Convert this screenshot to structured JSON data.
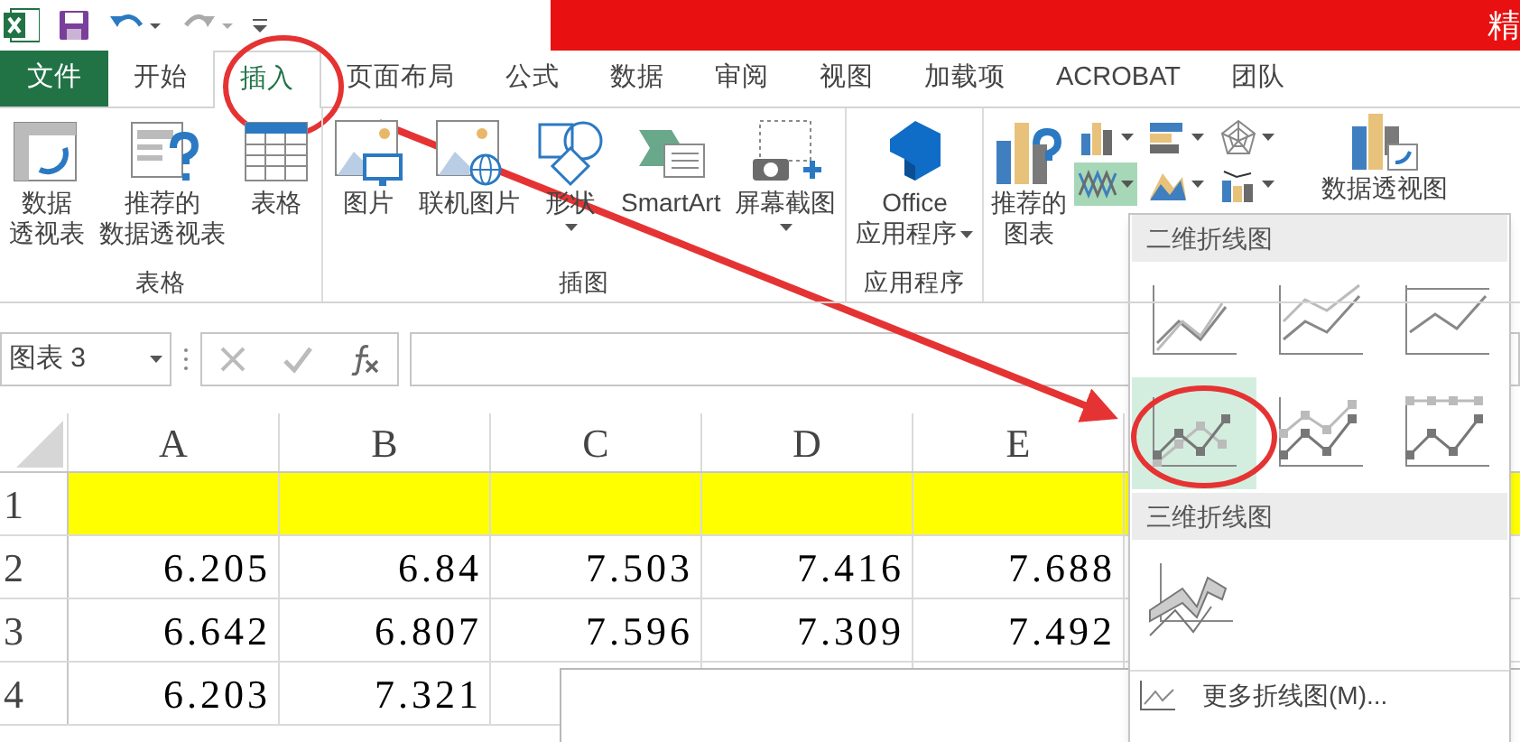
{
  "title_bar": {
    "title": "精"
  },
  "tabs": [
    {
      "label": "文件",
      "kind": "file",
      "selected": false
    },
    {
      "label": "开始",
      "kind": "tab",
      "selected": false
    },
    {
      "label": "插入",
      "kind": "tab",
      "selected": true
    },
    {
      "label": "页面布局",
      "kind": "tab",
      "selected": false
    },
    {
      "label": "公式",
      "kind": "tab",
      "selected": false
    },
    {
      "label": "数据",
      "kind": "tab",
      "selected": false
    },
    {
      "label": "审阅",
      "kind": "tab",
      "selected": false
    },
    {
      "label": "视图",
      "kind": "tab",
      "selected": false
    },
    {
      "label": "加载项",
      "kind": "tab",
      "selected": false
    },
    {
      "label": "ACROBAT",
      "kind": "tab",
      "selected": false
    },
    {
      "label": "团队",
      "kind": "tab",
      "selected": false
    }
  ],
  "ribbon": {
    "groups": [
      {
        "label": "表格",
        "buttons": [
          {
            "kind": "pivot",
            "lines": [
              "数据",
              "透视表"
            ],
            "dropdown": false
          },
          {
            "kind": "recommended_pivot",
            "lines": [
              "推荐的",
              "数据透视表"
            ],
            "dropdown": false
          },
          {
            "kind": "table",
            "lines": [
              "表格"
            ],
            "dropdown": false
          }
        ]
      },
      {
        "label": "插图",
        "buttons": [
          {
            "kind": "picture",
            "lines": [
              "图片"
            ],
            "dropdown": false
          },
          {
            "kind": "online_picture",
            "lines": [
              "联机图片"
            ],
            "dropdown": false
          },
          {
            "kind": "shapes",
            "lines": [
              "形状"
            ],
            "dropdown": true
          },
          {
            "kind": "smartart",
            "lines": [
              "SmartArt"
            ],
            "dropdown": false
          },
          {
            "kind": "screenshot",
            "lines": [
              "屏幕截图"
            ],
            "dropdown": true
          }
        ]
      },
      {
        "label": "应用程序",
        "buttons": [
          {
            "kind": "office",
            "lines": [
              "Office",
              "应用程序"
            ],
            "dropdown": true
          }
        ]
      }
    ]
  },
  "chart_group": {
    "recommended": [
      "推荐的",
      "图表"
    ],
    "small_buttons": [
      {
        "kind": "column",
        "selected": false
      },
      {
        "kind": "bar",
        "selected": false
      },
      {
        "kind": "radar",
        "selected": false
      },
      {
        "kind": "line",
        "selected": true
      },
      {
        "kind": "area",
        "selected": false
      },
      {
        "kind": "combo",
        "selected": false
      }
    ],
    "pivot_chart": "数据透视图"
  },
  "formula_bar": {
    "name_box": "图表 3"
  },
  "sheet": {
    "columns": [
      "A",
      "B",
      "C",
      "D",
      "E"
    ],
    "rows": [
      {
        "header": "1",
        "highlighted": true,
        "cells": []
      },
      {
        "header": "2",
        "highlighted": false,
        "cells": [
          "6.205",
          "6.84",
          "7.503",
          "7.416",
          "7.688"
        ]
      },
      {
        "header": "3",
        "highlighted": false,
        "cells": [
          "6.642",
          "6.807",
          "7.596",
          "7.309",
          "7.492"
        ]
      },
      {
        "header": "4",
        "highlighted": false,
        "cells": [
          "6.203",
          "7.321"
        ]
      }
    ]
  },
  "chart_menu": {
    "sections": [
      {
        "title": "二维折线图",
        "items": [
          {
            "kind": "line",
            "selected": false
          },
          {
            "kind": "stacked",
            "selected": false
          },
          {
            "kind": "percent",
            "selected": false
          },
          {
            "kind": "line_markers",
            "selected": true
          },
          {
            "kind": "stacked_markers",
            "selected": false
          },
          {
            "kind": "percent_markers",
            "selected": false
          }
        ]
      },
      {
        "title": "三维折线图",
        "items": [
          {
            "kind": "line_3d",
            "selected": false
          }
        ]
      }
    ],
    "more": "更多折线图(M)..."
  }
}
